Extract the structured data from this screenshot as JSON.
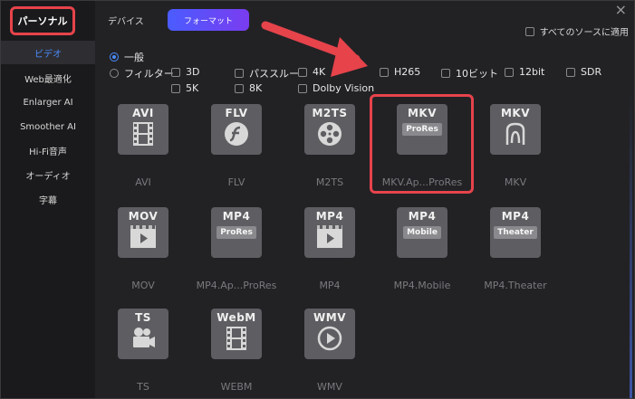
{
  "sidebar": {
    "top_label": "パーソナル",
    "items": [
      {
        "label": "ビデオ",
        "active": true
      },
      {
        "label": "Web最適化",
        "active": false
      },
      {
        "label": "Enlarger AI",
        "active": false
      },
      {
        "label": "Smoother AI",
        "active": false
      },
      {
        "label": "Hi-Fi音声",
        "active": false
      },
      {
        "label": "オーディオ",
        "active": false
      },
      {
        "label": "字幕",
        "active": false
      }
    ]
  },
  "header": {
    "tab_device": "デバイス",
    "tab_format": "フォーマット",
    "apply_all": "すべてのソースに適用",
    "close": "×"
  },
  "filters": {
    "general": "一般",
    "filter": "フィルター",
    "chips": [
      "3D",
      "パススルー",
      "4K",
      "H265",
      "10ビット",
      "12bit",
      "SDR",
      "5K",
      "8K",
      "Dolby Vision"
    ]
  },
  "formats": [
    {
      "tile": "AVI",
      "name": "AVI",
      "glyph": "film-icon"
    },
    {
      "tile": "FLV",
      "name": "FLV",
      "glyph": "flash-icon"
    },
    {
      "tile": "M2TS",
      "name": "M2TS",
      "glyph": "reel-icon"
    },
    {
      "tile": "MKV",
      "name": "MKV.Ap...ProRes",
      "glyph": "prores-badge",
      "badge": "ProRes"
    },
    {
      "tile": "MKV",
      "name": "MKV",
      "glyph": "matroska-icon"
    },
    {
      "tile": "MOV",
      "name": "MOV",
      "glyph": "clapper-play-icon"
    },
    {
      "tile": "MP4",
      "name": "MP4.Ap...ProRes",
      "glyph": "prores-badge",
      "badge": "ProRes"
    },
    {
      "tile": "MP4",
      "name": "MP4",
      "glyph": "clapper-play-icon"
    },
    {
      "tile": "MP4",
      "name": "MP4.Mobile",
      "glyph": "mobile-badge",
      "badge": "Mobile"
    },
    {
      "tile": "MP4",
      "name": "MP4.Theater",
      "glyph": "theater-badge",
      "badge": "Theater"
    },
    {
      "tile": "TS",
      "name": "TS",
      "glyph": "camcorder-icon"
    },
    {
      "tile": "WebM",
      "name": "WEBM",
      "glyph": "film-icon"
    },
    {
      "tile": "WMV",
      "name": "WMV",
      "glyph": "play-circle-icon"
    }
  ],
  "colors": {
    "accent": "#4b8cff",
    "annotation": "#e6434b",
    "tab_gradient_start": "#4a5cff",
    "tab_gradient_end": "#7a3cf0"
  }
}
